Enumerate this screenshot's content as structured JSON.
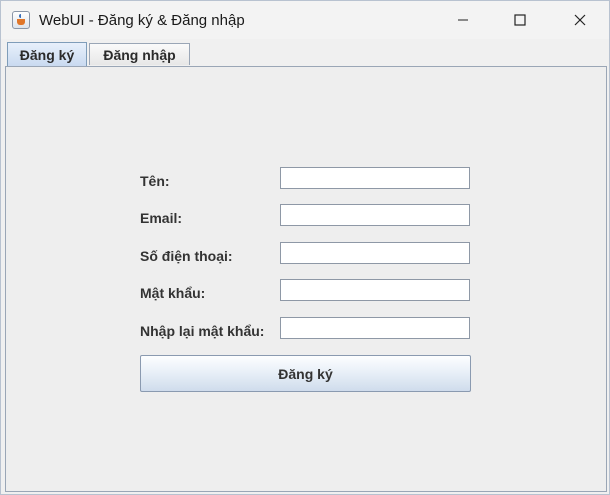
{
  "window": {
    "title": "WebUI - Đăng ký & Đăng nhập"
  },
  "tabs": [
    {
      "label": "Đăng ký",
      "active": true
    },
    {
      "label": "Đăng nhập",
      "active": false
    }
  ],
  "form": {
    "fields": [
      {
        "label": "Tên:",
        "value": ""
      },
      {
        "label": "Email:",
        "value": ""
      },
      {
        "label": "Số điện thoại:",
        "value": ""
      },
      {
        "label": "Mật khẩu:",
        "value": ""
      },
      {
        "label": "Nhập lại mật khẩu:",
        "value": ""
      }
    ],
    "submit_label": "Đăng ký"
  },
  "icons": {
    "app": "java-cup-icon",
    "minimize": "minimize-icon",
    "maximize": "maximize-icon",
    "close": "close-icon"
  },
  "colors": {
    "active_tab": "#c9daf0",
    "window_bg": "#f0f0f0",
    "button_gradient_bottom": "#cfdcec"
  }
}
